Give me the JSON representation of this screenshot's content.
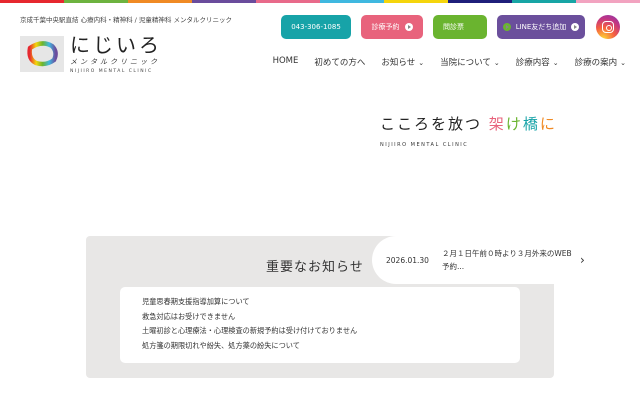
{
  "rainbow": [
    "#e6282f",
    "#6db33f",
    "#f08a24",
    "#6a4c9c",
    "#e86a8a",
    "#3fb8e0",
    "#f5d50c",
    "#1f1f7a",
    "#17a5a5",
    "#f2a3c0"
  ],
  "header": {
    "tagline": "京成千葉中央駅直結 心療内科・精神科 / 児童精神科 メンタルクリニック",
    "logo": {
      "jp": "にじいろ",
      "kana": "メンタルクリニック",
      "en": "NIJIIRO MENTAL CLINIC"
    },
    "buttons": [
      {
        "label": "043-306-1085",
        "color": "#17a3a8"
      },
      {
        "label": "診療予約",
        "color": "#e8637c"
      },
      {
        "label": "問診票",
        "color": "#6ab42f"
      },
      {
        "label": "LINE友だち追加",
        "color": "#6b4f9c"
      }
    ],
    "instagram": "instagram-icon"
  },
  "nav": [
    {
      "label": "HOME",
      "dropdown": false
    },
    {
      "label": "初めての方へ",
      "dropdown": false
    },
    {
      "label": "お知らせ",
      "dropdown": true
    },
    {
      "label": "当院について",
      "dropdown": true
    },
    {
      "label": "診療内容",
      "dropdown": true
    },
    {
      "label": "診療の案内",
      "dropdown": true
    }
  ],
  "hero": {
    "title_main": "こころを放つ",
    "title_accent": [
      "架",
      "け",
      "橋",
      "に"
    ],
    "accent_colors": [
      "#e8637c",
      "#6ab42f",
      "#17a3a8",
      "#f08a24"
    ],
    "subtitle": "NIJIIRO MENTAL CLINIC"
  },
  "news": {
    "date": "2026.01.30",
    "text": "２月１日午前０時より３月外来のWEB予約..."
  },
  "important": {
    "title": "重要なお知らせ",
    "items": [
      "児童思春期支援指導加算について",
      "救急対応はお受けできません",
      "土曜初診と心理療法・心理検査の新規予約は受け付けておりません",
      "処方箋の期限切れや紛失、処方薬の紛失について"
    ]
  }
}
